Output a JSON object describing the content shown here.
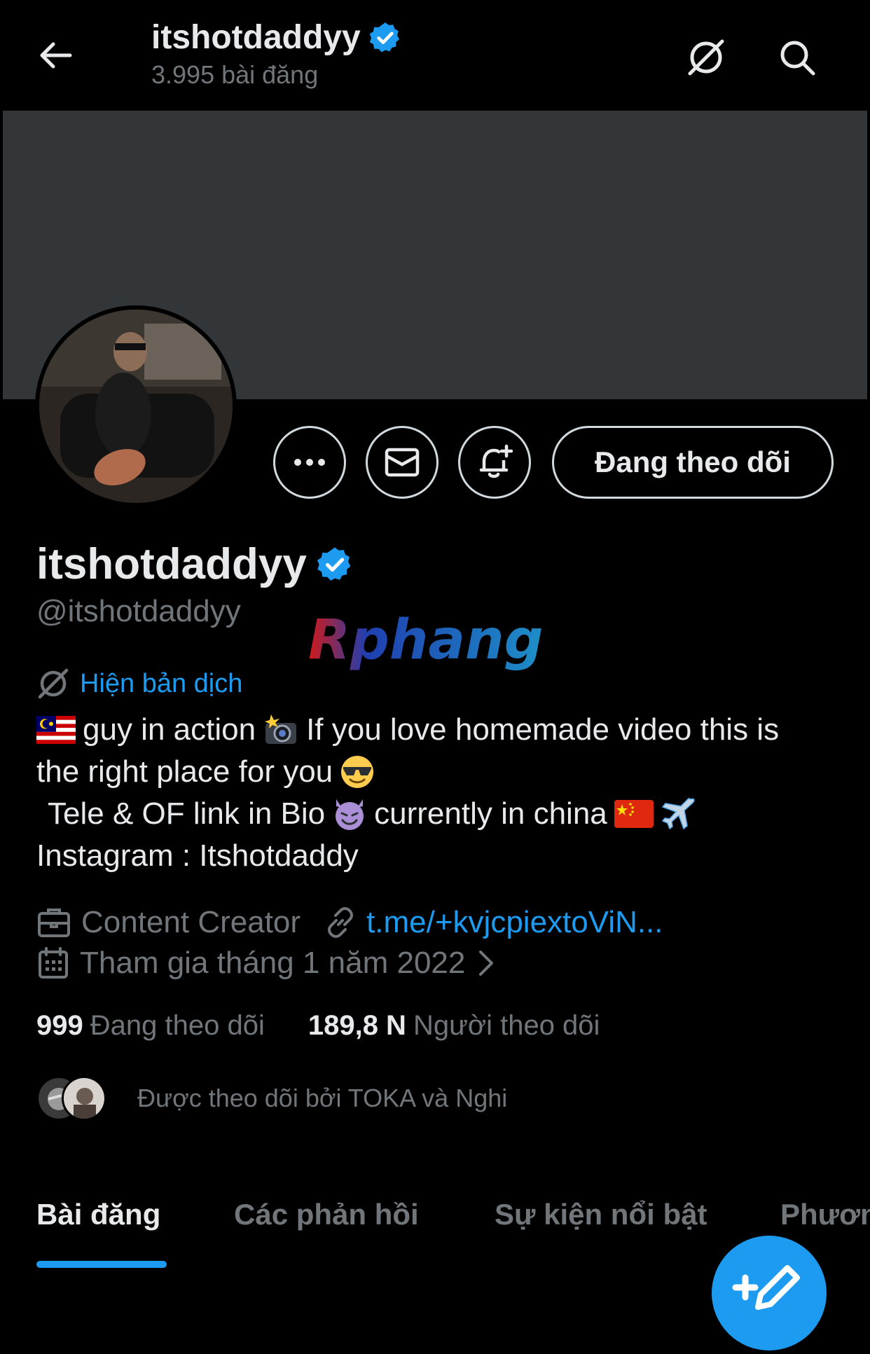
{
  "header": {
    "title": "itshotdaddyy",
    "post_count": "3.995 bài đăng"
  },
  "profile": {
    "display_name": "itshotdaddyy",
    "handle": "@itshotdaddyy",
    "verified_color": "#1d9bf0",
    "translate_label": "Hiện bản dịch",
    "bio": {
      "line1_a": "guy in action",
      "line1_b": "If you love homemade video this is",
      "line2": "the right place for you",
      "line3_a": "Tele & OF link in Bio",
      "line3_b": "currently in china",
      "line4": "Instagram : Itshotdaddy"
    },
    "category": "Content Creator",
    "link": "t.me/+kvjcpiextoViN...",
    "joined": "Tham gia tháng 1 năm 2022",
    "following_count": "999",
    "following_label": "Đang theo dõi",
    "followers_count": "189,8 N",
    "followers_label": "Người theo dõi",
    "followed_by": "Được theo dõi bởi TOKA và Nghi"
  },
  "actions": {
    "following_button": "Đang theo dõi"
  },
  "watermark": "Rphang",
  "tabs": [
    {
      "label": "Bài đăng",
      "active": true
    },
    {
      "label": "Các phản hồi",
      "active": false
    },
    {
      "label": "Sự kiện nổi bật",
      "active": false
    },
    {
      "label": "Phươn",
      "active": false
    }
  ],
  "colors": {
    "background": "#000000",
    "banner": "#333639",
    "accent": "#1d9bf0",
    "secondary_text": "#71767b"
  }
}
